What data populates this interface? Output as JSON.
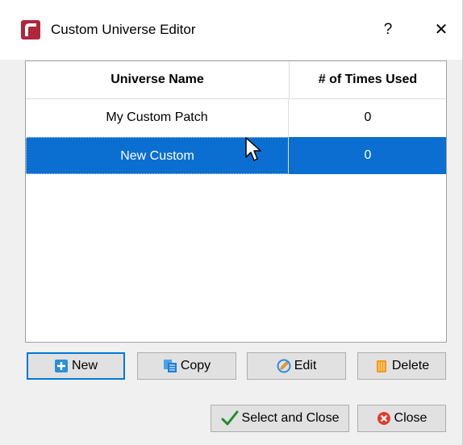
{
  "window": {
    "title": "Custom Universe Editor",
    "help_label": "?",
    "close_label": "✕"
  },
  "table": {
    "headers": [
      "Universe Name",
      "# of Times Used"
    ],
    "rows": [
      {
        "name": "My Custom Patch",
        "used": "0",
        "selected": false
      },
      {
        "name": "New Custom",
        "used": "0",
        "selected": true
      }
    ]
  },
  "buttons": {
    "new": "New",
    "copy": "Copy",
    "edit": "Edit",
    "delete": "Delete",
    "select_close": "Select and Close",
    "close": "Close"
  },
  "icons": {
    "app": "app-logo-icon",
    "new": "new-document-icon",
    "copy": "copy-icon",
    "edit": "edit-icon",
    "delete": "delete-icon",
    "select_close": "checkmark-icon",
    "close": "close-circle-icon"
  },
  "colors": {
    "selection": "#0a6fd0",
    "default_button_border": "#0078d7",
    "app_icon": "#b0263a"
  }
}
